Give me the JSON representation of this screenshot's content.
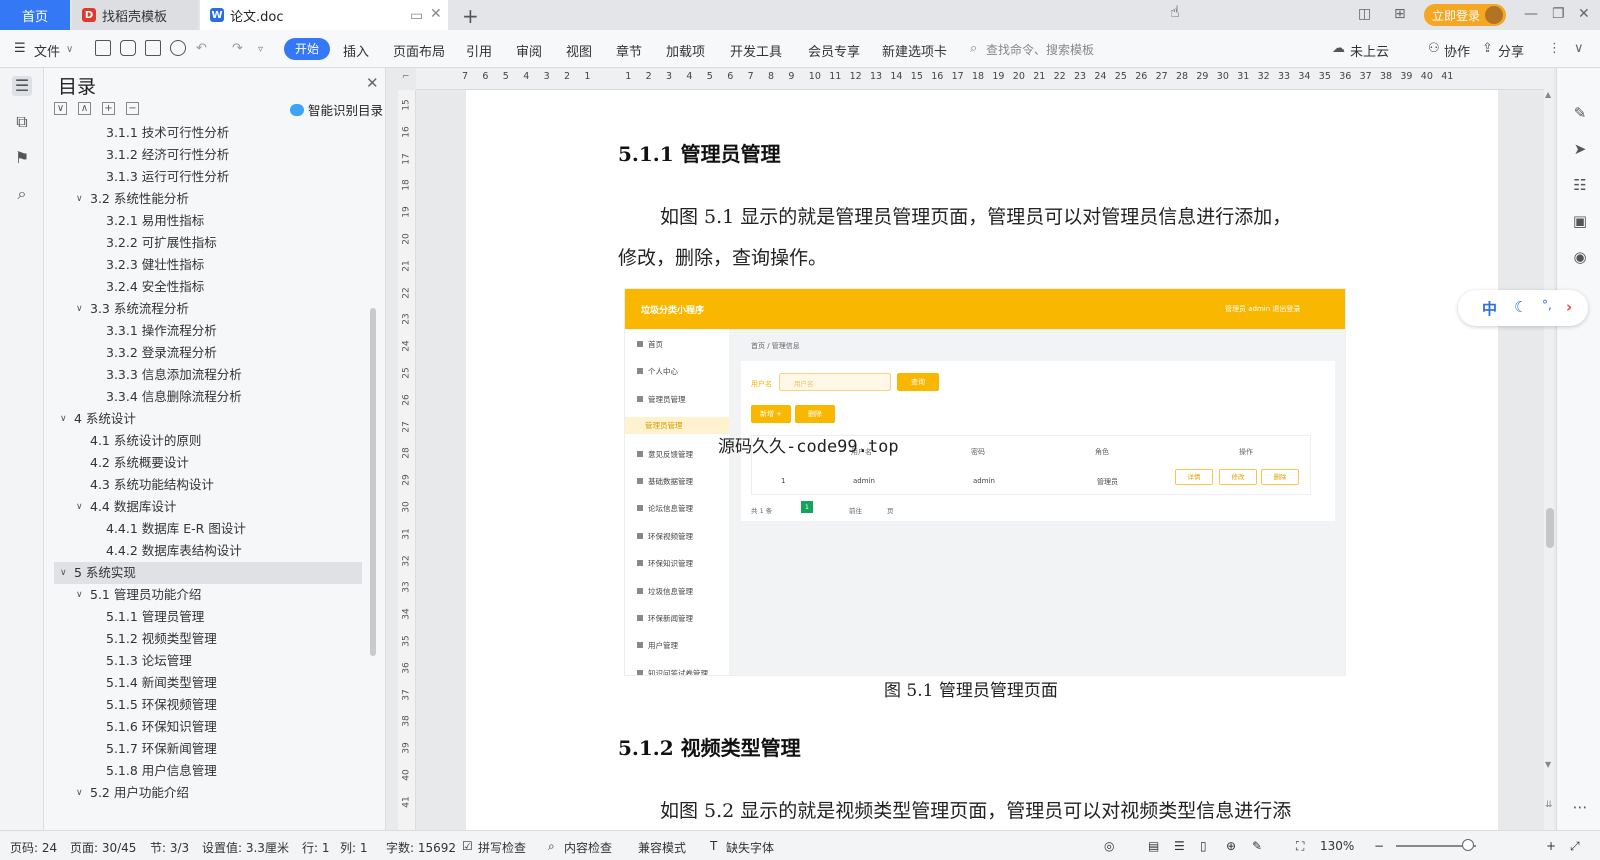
{
  "tabs": {
    "home": "首页",
    "template": "找稻壳模板",
    "doc": "论文.doc",
    "new_tab": "+",
    "login": "立即登录"
  },
  "toolbar": {
    "file": "文件",
    "menus": [
      "开始",
      "插入",
      "页面布局",
      "引用",
      "审阅",
      "视图",
      "章节",
      "加载项",
      "开发工具",
      "会员专享",
      "新建选项卡"
    ],
    "search_placeholder": "查找命令、搜索模板",
    "cloud": "未上云",
    "collab": "协作",
    "share": "分享"
  },
  "toc": {
    "title": "目录",
    "smart": "智能识别目录",
    "items": [
      {
        "label": "3.1.1  技术可行性分析",
        "level": 3
      },
      {
        "label": "3.1.2  经济可行性分析",
        "level": 3
      },
      {
        "label": "3.1.3  运行可行性分析",
        "level": 3
      },
      {
        "label": "3.2  系统性能分析",
        "level": 2,
        "caret": true
      },
      {
        "label": "3.2.1  易用性指标",
        "level": 3
      },
      {
        "label": "3.2.2  可扩展性指标",
        "level": 3
      },
      {
        "label": "3.2.3  健壮性指标",
        "level": 3
      },
      {
        "label": "3.2.4  安全性指标",
        "level": 3
      },
      {
        "label": "3.3  系统流程分析",
        "level": 2,
        "caret": true
      },
      {
        "label": "3.3.1  操作流程分析",
        "level": 3
      },
      {
        "label": "3.3.2  登录流程分析",
        "level": 3
      },
      {
        "label": "3.3.3  信息添加流程分析",
        "level": 3
      },
      {
        "label": "3.3.4  信息删除流程分析",
        "level": 3
      },
      {
        "label": "4  系统设计",
        "level": 1,
        "caret": true
      },
      {
        "label": "4.1  系统设计的原则",
        "level": 2
      },
      {
        "label": "4.2  系统概要设计",
        "level": 2
      },
      {
        "label": "4.3  系统功能结构设计",
        "level": 2
      },
      {
        "label": "4.4  数据库设计",
        "level": 2,
        "caret": true
      },
      {
        "label": "4.4.1  数据库 E-R 图设计",
        "level": 3
      },
      {
        "label": "4.4.2  数据库表结构设计",
        "level": 3
      },
      {
        "label": "5  系统实现",
        "level": 1,
        "caret": true,
        "selected": true
      },
      {
        "label": "5.1  管理员功能介绍",
        "level": 2,
        "caret": true
      },
      {
        "label": "5.1.1  管理员管理",
        "level": 3
      },
      {
        "label": "5.1.2  视频类型管理",
        "level": 3
      },
      {
        "label": "5.1.3  论坛管理",
        "level": 3
      },
      {
        "label": "5.1.4  新闻类型管理",
        "level": 3
      },
      {
        "label": "5.1.5  环保视频管理",
        "level": 3
      },
      {
        "label": "5.1.6  环保知识管理",
        "level": 3
      },
      {
        "label": "5.1.7  环保新闻管理",
        "level": 3
      },
      {
        "label": "5.1.8  用户信息管理",
        "level": 3
      },
      {
        "label": "5.2  用户功能介绍",
        "level": 2,
        "caret": true
      }
    ]
  },
  "ruler": {
    "h": [
      "7",
      "6",
      "5",
      "4",
      "3",
      "2",
      "1",
      "",
      "1",
      "2",
      "3",
      "4",
      "5",
      "6",
      "7",
      "8",
      "9",
      "10",
      "11",
      "12",
      "13",
      "14",
      "15",
      "16",
      "17",
      "18",
      "19",
      "20",
      "21",
      "22",
      "23",
      "24",
      "25",
      "26",
      "27",
      "28",
      "29",
      "30",
      "31",
      "32",
      "33",
      "34",
      "35",
      "36",
      "37",
      "38",
      "39",
      "40",
      "41"
    ],
    "v": [
      "15",
      "16",
      "17",
      "18",
      "19",
      "20",
      "21",
      "22",
      "23",
      "24",
      "25",
      "26",
      "27",
      "28",
      "29",
      "30",
      "31",
      "32",
      "33",
      "34",
      "35",
      "36",
      "37",
      "38",
      "39",
      "40",
      "41"
    ]
  },
  "doc": {
    "h_511": "5.1.1  管理员管理",
    "p1_line1": "如图 5.1 显示的就是管理员管理页面，管理员可以对管理员信息进行添加，",
    "p1_line2": "修改，删除，查询操作。",
    "caption": "图 5.1  管理员管理页面",
    "h_512": "5.1.2  视频类型管理",
    "p2_line1": "如图 5.2 显示的就是视频类型管理页面，管理员可以对视频类型信息进行添",
    "watermark": "源码久久-code99.top"
  },
  "figure": {
    "app_title": "垃圾分类小程序",
    "header_right": "管理员 admin   退出登录",
    "sidebar": [
      "首页",
      "个人中心",
      "管理员管理",
      "管理员管理",
      "意见反馈管理",
      "基础数据管理",
      "论坛信息管理",
      "环保视频管理",
      "环保知识管理",
      "垃圾信息管理",
      "环保新闻管理",
      "用户管理",
      "知识问答试卷管理"
    ],
    "breadcrumb": "首页  /  管理信息",
    "search_label": "用户名",
    "search_placeholder": "用户名",
    "search_btn": "查询",
    "add_btn": "新增 +",
    "del_btn": "删除",
    "cols": [
      "用户名",
      "密码",
      "角色",
      "操作"
    ],
    "row": [
      "1",
      "admin",
      "admin",
      "管理员"
    ],
    "ops": [
      "详情",
      "修改",
      "删除"
    ],
    "pager_total": "共 1 条",
    "pager_page": "1",
    "pager_goto": "前往",
    "pager_unit": "页"
  },
  "ime": {
    "zh": "中"
  },
  "status": {
    "page_no": "页码: 24",
    "pages": "页面: 30/45",
    "section": "节: 3/3",
    "setting": "设置值: 3.3厘米",
    "row": "行: 1",
    "col": "列: 1",
    "words": "字数: 15692",
    "spell": "拼写检查",
    "content_check": "内容检查",
    "compat": "兼容模式",
    "missing_font": "缺失字体",
    "zoom": "130%"
  }
}
